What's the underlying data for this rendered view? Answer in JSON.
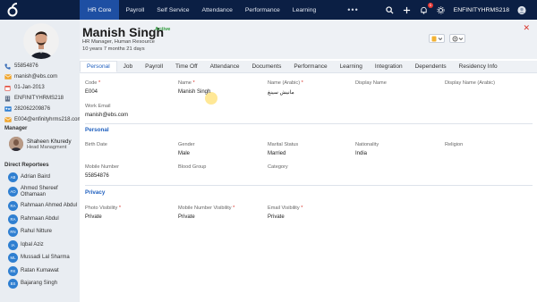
{
  "nav": {
    "tabs": [
      "HR Core",
      "Payroll",
      "Self Service",
      "Attendance",
      "Performance",
      "Learning"
    ],
    "active_tab": "HR Core",
    "more": "•••",
    "notification_count": "1",
    "company": "ENFINITYHRMS218",
    "colors": {
      "bar": "#0b1f44",
      "active": "#1e4fa3"
    }
  },
  "employee": {
    "name": "Manish Singh",
    "status": "Active",
    "role": "HR Manager, Human Resource",
    "tenure": "10 years 7 months 21 days"
  },
  "sidebar": {
    "info": [
      {
        "icon": "phone-icon",
        "text": "55854876"
      },
      {
        "icon": "email-icon",
        "text": "manish@ebs.com"
      },
      {
        "icon": "calendar-icon",
        "text": "01-Jan-2013"
      },
      {
        "icon": "company-icon",
        "text": "ENFINITYHRMS218"
      },
      {
        "icon": "id-card-icon",
        "text": "282062209876"
      },
      {
        "icon": "email-icon",
        "text": "E004@enfinityhrms218.com"
      }
    ],
    "manager_heading": "Manager",
    "manager": {
      "name": "Shaheen Khuredy",
      "role": "Head Managment"
    },
    "reportees_heading": "Direct Reportees",
    "reportees": [
      {
        "initials": "AB",
        "name": "Adrian Baird"
      },
      {
        "initials": "AO",
        "name": "Ahmed Shereef Othamaan"
      },
      {
        "initials": "RA",
        "name": "Rahmaan Ahmed Abdul"
      },
      {
        "initials": "RA",
        "name": "Rahmaan Abdul"
      },
      {
        "initials": "RN",
        "name": "Rahul Nitture"
      },
      {
        "initials": "IA",
        "name": "Iqbal Aziz"
      },
      {
        "initials": "ML",
        "name": "Mussadi Lal Sharma"
      },
      {
        "initials": "RK",
        "name": "Ratan Kumawat"
      },
      {
        "initials": "BS",
        "name": "Bajarang Singh"
      }
    ]
  },
  "tabs": [
    "Personal",
    "Job",
    "Payroll",
    "Time Off",
    "Attendance",
    "Documents",
    "Performance",
    "Learning",
    "Integration",
    "Dependents",
    "Residency Info"
  ],
  "active_tab": "Personal",
  "form": {
    "code": {
      "label": "Code",
      "value": "E004"
    },
    "name": {
      "label": "Name",
      "value": "Manish Singh"
    },
    "name_ar": {
      "label": "Name (Arabic)",
      "value": "مانيش سينغ"
    },
    "display_name": {
      "label": "Display Name",
      "value": ""
    },
    "display_name_ar": {
      "label": "Display Name (Arabic)",
      "value": ""
    },
    "work_email": {
      "label": "Work Email",
      "value": "manish@ebs.com"
    },
    "personal_heading": "Personal",
    "birth_date": {
      "label": "Birth Date",
      "value": ""
    },
    "gender": {
      "label": "Gender",
      "value": "Male"
    },
    "marital": {
      "label": "Marital Status",
      "value": "Married"
    },
    "nationality": {
      "label": "Nationality",
      "value": "India"
    },
    "religion": {
      "label": "Religion",
      "value": ""
    },
    "mobile": {
      "label": "Mobile Number",
      "value": "55854876"
    },
    "blood": {
      "label": "Blood Group",
      "value": ""
    },
    "category": {
      "label": "Category",
      "value": ""
    },
    "privacy_heading": "Privacy",
    "photo_vis": {
      "label": "Photo Visibility",
      "value": "Private"
    },
    "mobile_vis": {
      "label": "Mobile Number Visibility",
      "value": "Private"
    },
    "email_vis": {
      "label": "Email Visibility",
      "value": "Private"
    }
  }
}
